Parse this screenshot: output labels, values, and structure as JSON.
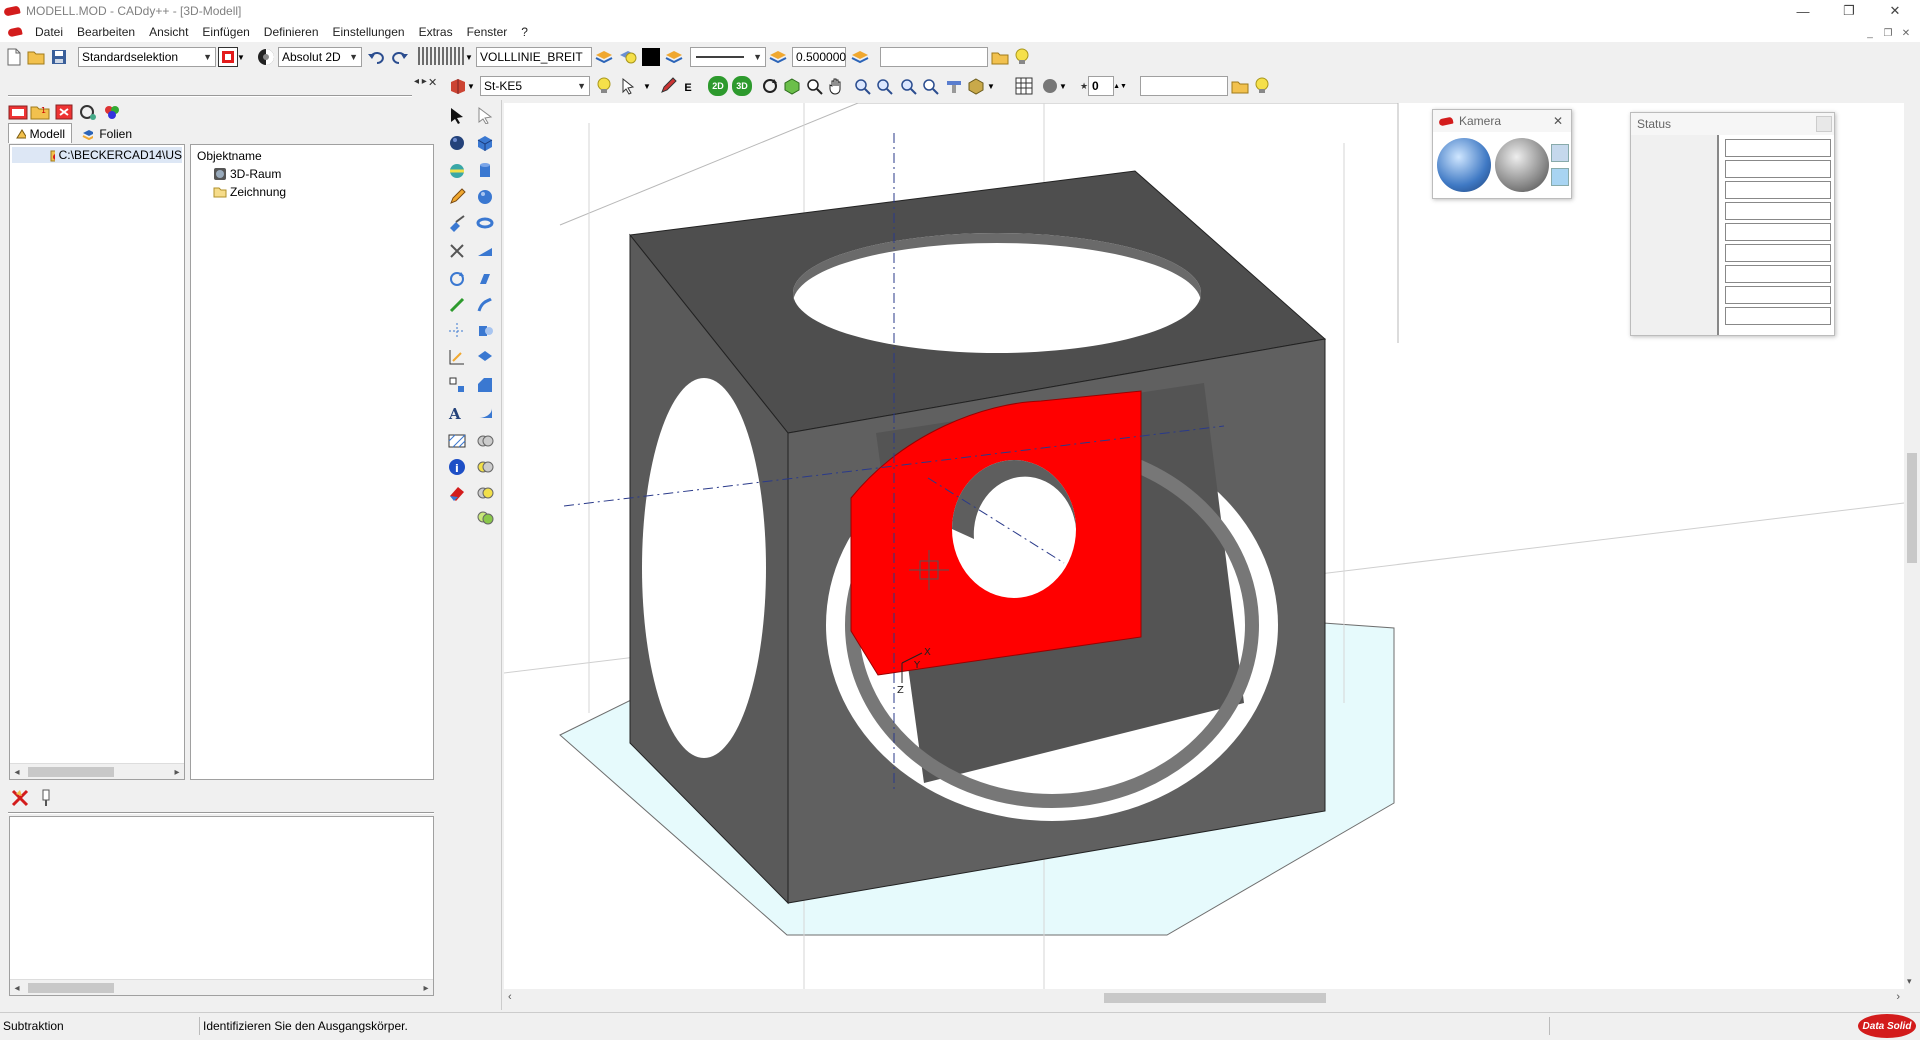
{
  "window": {
    "title": "MODELL.MOD  -  CADdy++ - [3D-Modell]",
    "controls": {
      "minimize": "—",
      "restore": "❐",
      "close": "✕"
    },
    "mdi_controls": {
      "minimize": "_",
      "restore": "❐",
      "close": "✕"
    }
  },
  "menu": {
    "items": [
      "Datei",
      "Bearbeiten",
      "Ansicht",
      "Einfügen",
      "Definieren",
      "Einstellungen",
      "Extras",
      "Fenster",
      "?"
    ]
  },
  "toolbar1": {
    "selection_mode": "Standardselektion",
    "coord_mode": "Absolut 2D",
    "line_type": "VOLLLINIE_BREIT",
    "line_width": "0.500000",
    "extra_field": ""
  },
  "toolbar2": {
    "material": "St-KE5",
    "spin_value": "0",
    "extra_field": ""
  },
  "left_panel": {
    "tabs": [
      {
        "label": "Modell",
        "active": true
      },
      {
        "label": "Folien",
        "active": false
      }
    ],
    "path": "C:\\BECKERCAD14\\US",
    "objects_header": "Objektname",
    "objects": [
      {
        "label": "3D-Raum",
        "icon": "3d-space-icon"
      },
      {
        "label": "Zeichnung",
        "icon": "folder-icon"
      }
    ]
  },
  "camera": {
    "title": "Kamera"
  },
  "status_window": {
    "title": "Status",
    "fields": [
      "",
      "",
      "",
      "",
      "",
      "",
      "",
      "",
      "",
      ""
    ]
  },
  "statusbar": {
    "command": "Subtraktion",
    "prompt": "Identifizieren Sie den Ausgangskörper.",
    "brand": "Data Solid"
  },
  "colors": {
    "accent_red": "#d31c1c",
    "model_gray": "#5c5c5c",
    "selected_face": "#ff0000",
    "plane_fill": "#e6fafc"
  }
}
